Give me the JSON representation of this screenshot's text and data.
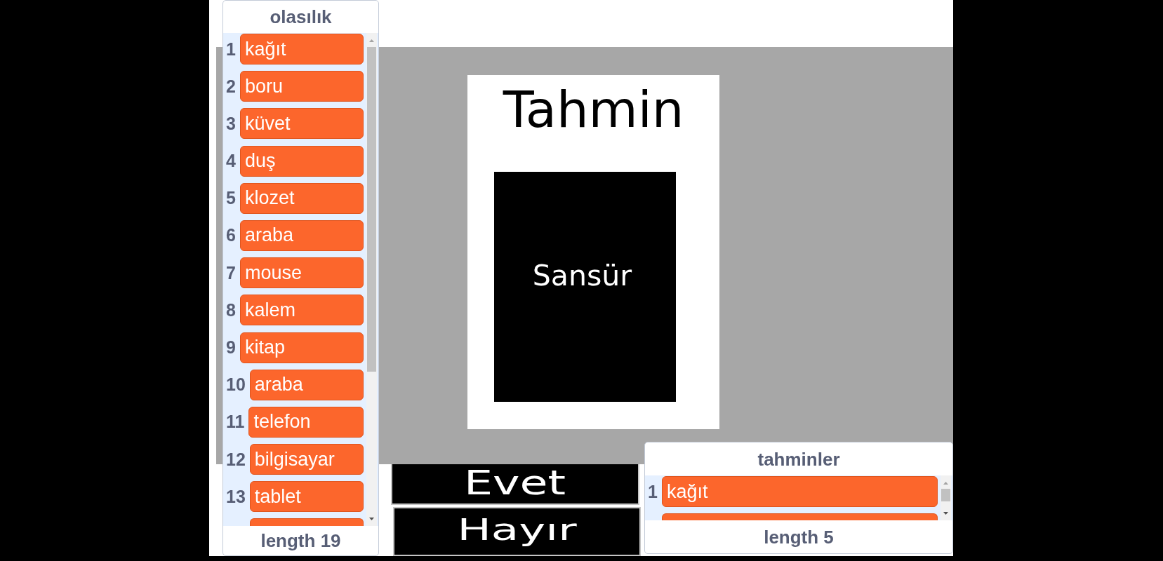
{
  "list_monitors": [
    {
      "title": "olasılık",
      "items": [
        {
          "index": "1",
          "value": "kağıt"
        },
        {
          "index": "2",
          "value": "boru"
        },
        {
          "index": "3",
          "value": "küvet"
        },
        {
          "index": "4",
          "value": "duş"
        },
        {
          "index": "5",
          "value": "klozet"
        },
        {
          "index": "6",
          "value": "araba"
        },
        {
          "index": "7",
          "value": "mouse"
        },
        {
          "index": "8",
          "value": "kalem"
        },
        {
          "index": "9",
          "value": "kitap"
        },
        {
          "index": "10",
          "value": "araba"
        },
        {
          "index": "11",
          "value": "telefon"
        },
        {
          "index": "12",
          "value": "bilgisayar"
        },
        {
          "index": "13",
          "value": "tablet"
        }
      ],
      "more_below": true,
      "footer": "length 19"
    },
    {
      "title": "tahminler",
      "items": [
        {
          "index": "1",
          "value": "kağıt"
        }
      ],
      "more_below": true,
      "footer": "length 5"
    }
  ],
  "card": {
    "title": "Tahmin",
    "censor_label": "Sansür"
  },
  "answer_buttons": [
    {
      "label": "Evet"
    },
    {
      "label": "Hayır"
    }
  ]
}
